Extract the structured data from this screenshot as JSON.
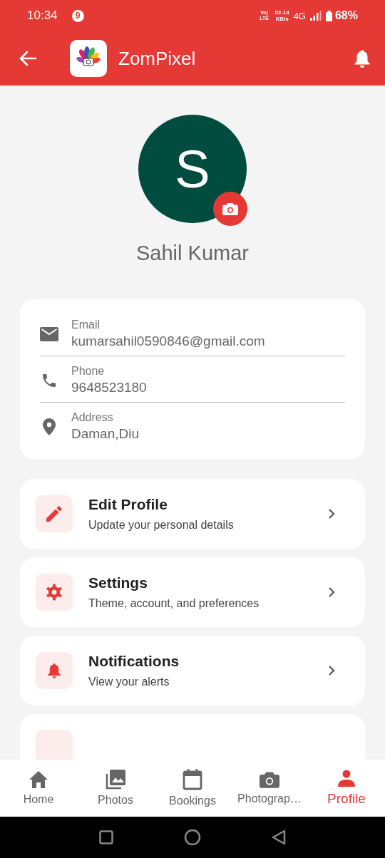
{
  "status_bar": {
    "time": "10:34",
    "notification_count": "9",
    "volte": "Vo) LTE",
    "speed_value": "52.14",
    "speed_unit": "KB/s",
    "network": "4G",
    "battery": "68%"
  },
  "app_bar": {
    "title": "ZomPixel"
  },
  "profile": {
    "initial": "S",
    "name": "Sahil Kumar"
  },
  "contact": [
    {
      "label": "Email",
      "value": "kumarsahil0590846@gmail.com"
    },
    {
      "label": "Phone",
      "value": "9648523180"
    },
    {
      "label": "Address",
      "value": "Daman,Diu"
    }
  ],
  "menu": [
    {
      "title": "Edit Profile",
      "subtitle": "Update your personal details"
    },
    {
      "title": "Settings",
      "subtitle": "Theme, account, and preferences"
    },
    {
      "title": "Notifications",
      "subtitle": "View your alerts"
    }
  ],
  "bottom_nav": [
    {
      "label": "Home",
      "selected": false
    },
    {
      "label": "Photos",
      "selected": false
    },
    {
      "label": "Bookings",
      "selected": false
    },
    {
      "label": "Photograp…",
      "selected": false
    },
    {
      "label": "Profile",
      "selected": true
    }
  ]
}
